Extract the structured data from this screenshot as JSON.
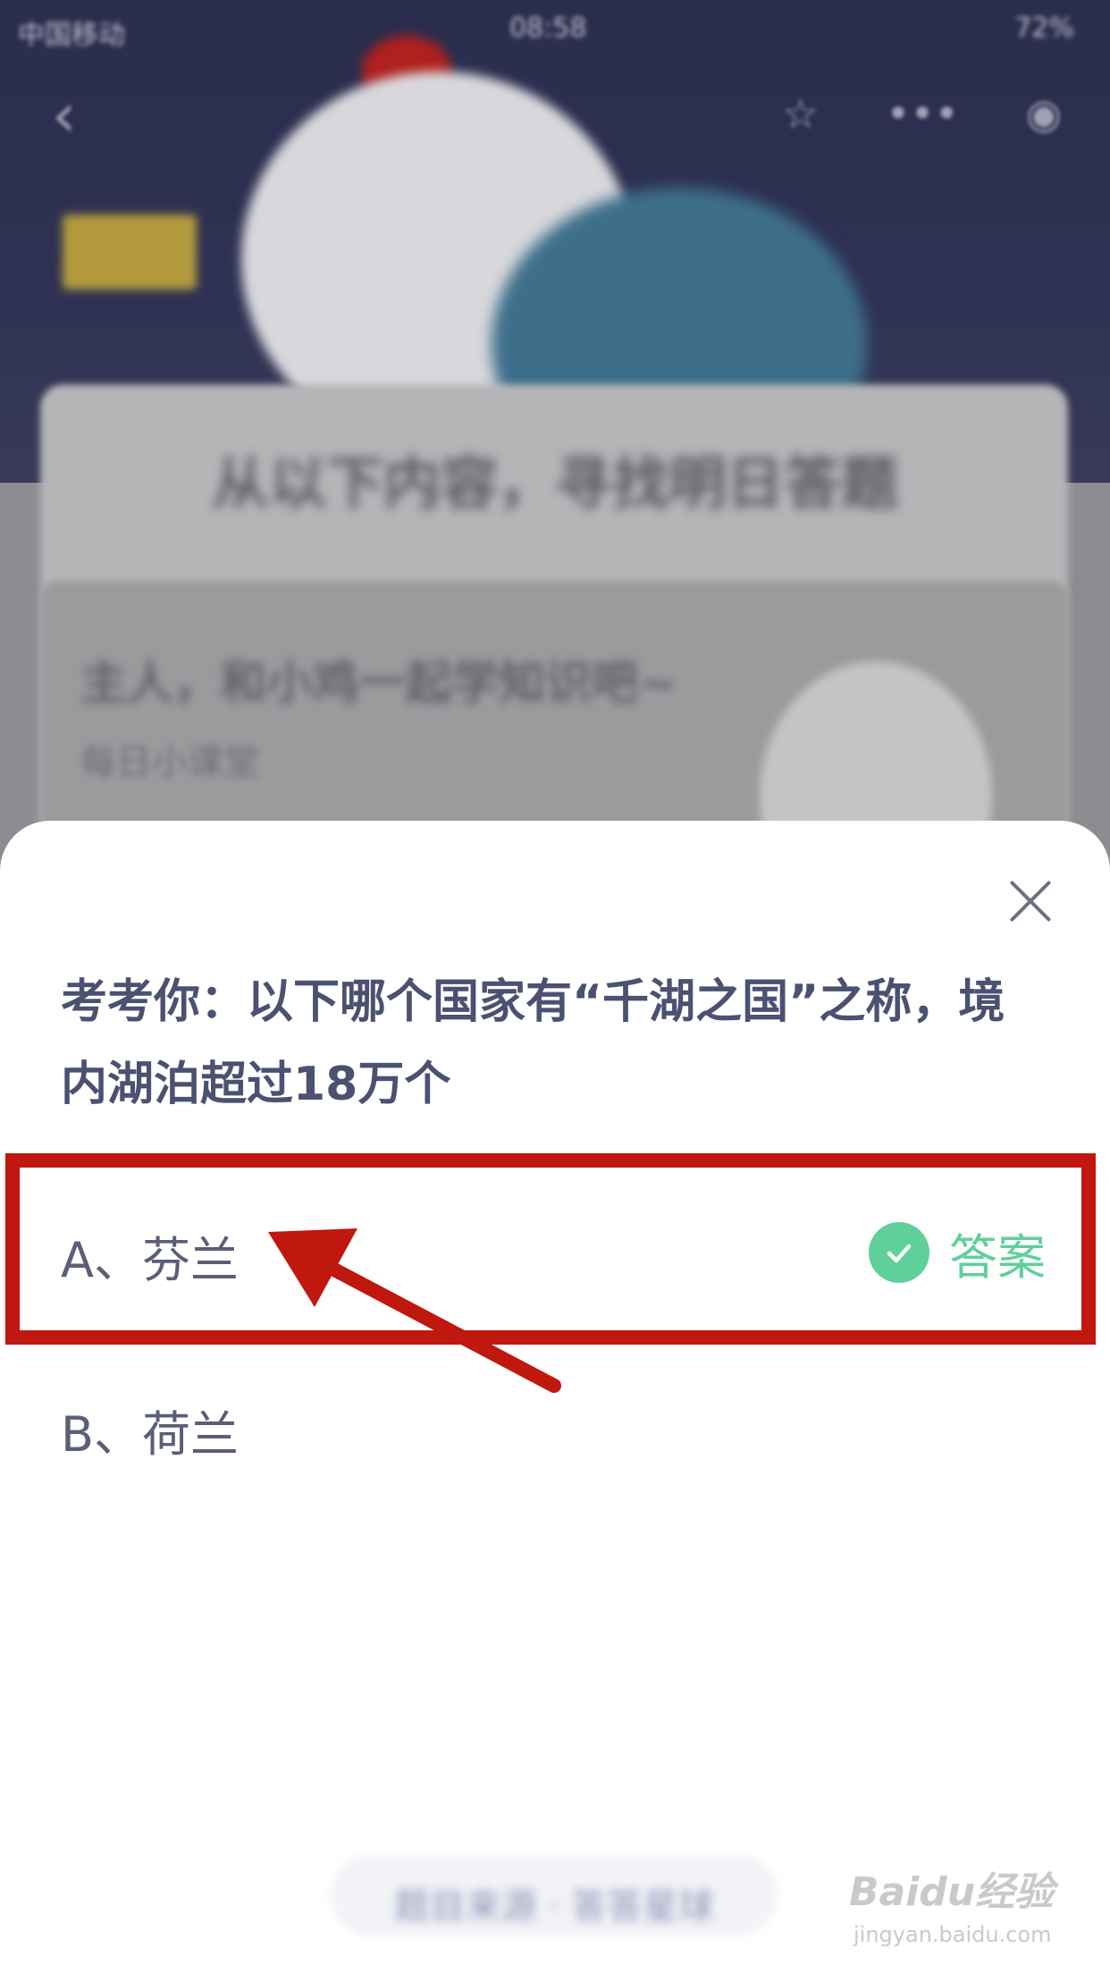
{
  "status_bar": {
    "carrier": "中国移动",
    "time": "08:58",
    "battery": "72%"
  },
  "background": {
    "heading": "从以下内容，寻找明日答题",
    "card_title": "主人，和小鸡一起学知识吧~",
    "card_subtitle": "每日小课堂"
  },
  "quiz": {
    "question": "考考你：以下哪个国家有“千湖之国”之称，境内湖泊超过18万个",
    "options": [
      {
        "label": "A、芬兰",
        "correct": true
      },
      {
        "label": "B、荷兰",
        "correct": false
      }
    ],
    "answer_label": "答案"
  },
  "footer": {
    "button_text": "题目来源 · 答答星球"
  },
  "watermark": {
    "brand": "Baidu经验",
    "url": "jingyan.baidu.com"
  },
  "colors": {
    "correct_green": "#5fd09a",
    "highlight_red": "#c0170f",
    "question_text": "#4a5171"
  },
  "icons": [
    "back-icon",
    "star-icon",
    "more-icon",
    "target-icon",
    "close-icon",
    "check-icon"
  ]
}
